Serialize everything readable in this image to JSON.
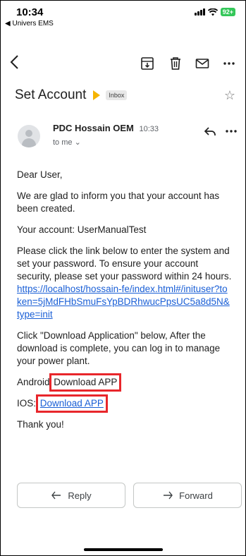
{
  "status_bar": {
    "time": "10:34",
    "back_app": "◀ Univers EMS",
    "battery": "92+"
  },
  "toolbar": {
    "back_icon": "chevron-left-icon",
    "archive_icon": "archive-icon",
    "delete_icon": "trash-icon",
    "mark_unread_icon": "mail-icon",
    "more_icon": "more-horizontal-icon"
  },
  "email": {
    "subject": "Set Account",
    "label": "Inbox",
    "sender_name": "PDC Hossain OEM",
    "sent_time": "10:33",
    "to": "to me ⌄",
    "greeting": "Dear User,",
    "para1": "We are glad to inform you that your account has been created.",
    "para2": "Your account: UserManualTest",
    "para3": "Please click the link below to enter the system and set your password. To ensure your account security, please set your password within 24 hours.",
    "link": "https://localhost/hossain-fe/index.html#/inituser?token=5jMdFHbSmuFsYpBDRhwucPpsUC5a8d5N&type=init",
    "para4": "Click \"Download Application\" below, After the download is complete, you can log in to manage your power plant.",
    "android_label": "Android:",
    "android_link": "Download APP",
    "ios_label": "IOS:",
    "ios_link": "Download APP",
    "closing": "Thank you!"
  },
  "actions": {
    "reply": "Reply",
    "forward": "Forward"
  },
  "colors": {
    "link": "#1a5fd6",
    "highlight_box": "#e8262b",
    "important_marker": "#f5b400",
    "battery": "#34c759"
  }
}
